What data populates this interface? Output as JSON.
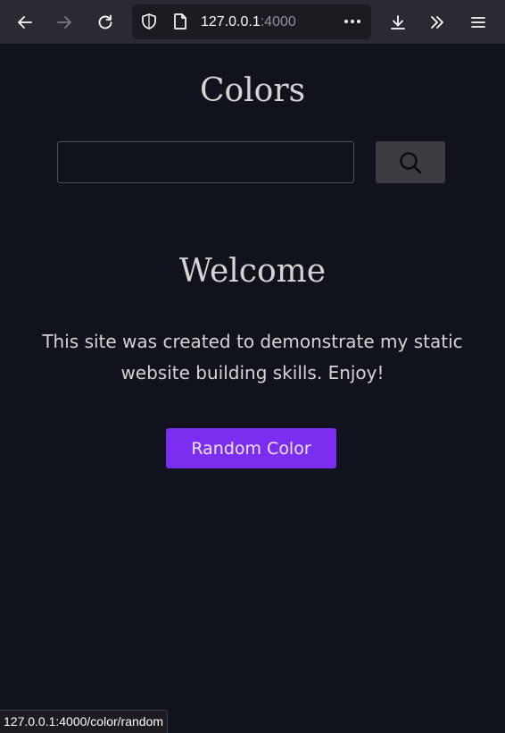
{
  "browser": {
    "url_host": "127.0.0.1",
    "url_port": ":4000"
  },
  "page": {
    "site_title": "Colors",
    "search": {
      "value": "",
      "placeholder": ""
    },
    "welcome_heading": "Welcome",
    "intro_text": "This site was created to demonstrate my static website building skills. Enjoy!",
    "random_button_label": "Random Color"
  },
  "status_bar": {
    "text": "127.0.0.1:4000/color/random"
  },
  "colors": {
    "page_background": "#10131b",
    "browser_chrome": "#2b2a33",
    "accent_button": "#7c2ef0",
    "search_button": "#3b3d42"
  }
}
